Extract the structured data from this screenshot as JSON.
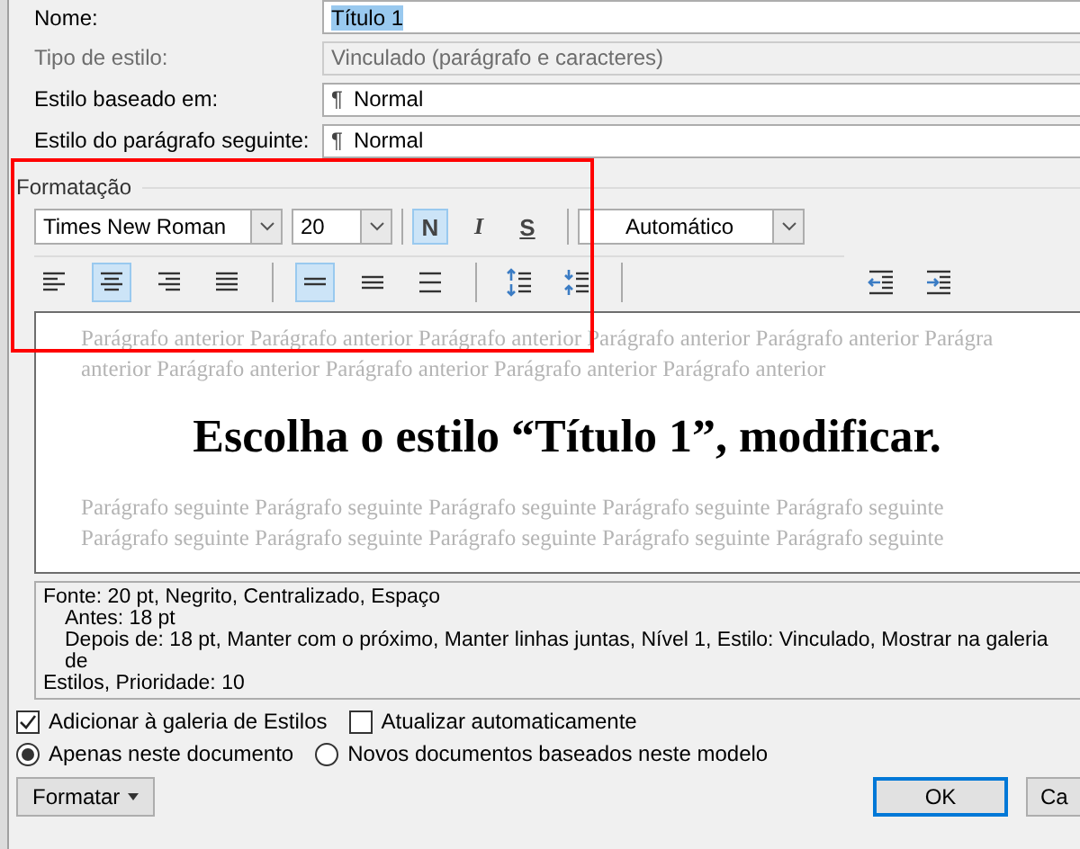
{
  "fields": [
    {
      "label": "Nome:",
      "value": "Título 1",
      "disabled": false,
      "kind": "text"
    },
    {
      "label": "Tipo de estilo:",
      "value": "Vinculado (parágrafo e caracteres)",
      "disabled": true,
      "kind": "text"
    },
    {
      "label": "Estilo baseado em:",
      "value": "Normal",
      "icon": "¶",
      "disabled": false,
      "kind": "style"
    },
    {
      "label": "Estilo do parágrafo seguinte:",
      "value": "Normal",
      "icon": "¶",
      "disabled": false,
      "kind": "style"
    }
  ],
  "formatting": {
    "title": "Formatação",
    "font": "Times New Roman",
    "size": "20",
    "styles": [
      {
        "label": "N",
        "kind": "bold",
        "selected": true
      },
      {
        "label": "I",
        "kind": "italic",
        "selected": false
      },
      {
        "label": "S",
        "kind": "underline",
        "selected": false
      }
    ],
    "color_label": "Automático",
    "tools": [
      {
        "kind": "align-left",
        "selected": false
      },
      {
        "kind": "align-center",
        "selected": true
      },
      {
        "kind": "align-right",
        "selected": false
      },
      {
        "kind": "justify",
        "selected": false
      },
      {
        "kind": "sep"
      },
      {
        "kind": "spacing-single",
        "selected": true
      },
      {
        "kind": "spacing-onehalf",
        "selected": false
      },
      {
        "kind": "spacing-double",
        "selected": false
      },
      {
        "kind": "sep"
      },
      {
        "kind": "space-more",
        "selected": false
      },
      {
        "kind": "space-less",
        "selected": false
      },
      {
        "kind": "sep"
      },
      {
        "kind": "indent-less",
        "selected": false
      },
      {
        "kind": "indent-more",
        "selected": false
      }
    ]
  },
  "preview": {
    "before": [
      "Parágrafo anterior Parágrafo anterior Parágrafo anterior Parágrafo anterior Parágrafo anterior Parágra",
      "anterior Parágrafo anterior Parágrafo anterior Parágrafo anterior Parágrafo anterior"
    ],
    "sample": "Escolha o estilo “Título 1”, modificar.",
    "after": [
      "Parágrafo seguinte Parágrafo seguinte Parágrafo seguinte Parágrafo seguinte Parágrafo seguinte",
      "Parágrafo seguinte Parágrafo seguinte Parágrafo seguinte Parágrafo seguinte Parágrafo seguinte"
    ]
  },
  "description": [
    {
      "text": "Fonte: 20 pt, Negrito, Centralizado, Espaço",
      "indented": false
    },
    {
      "text": "Antes:  18 pt",
      "indented": true
    },
    {
      "text": "Depois de:  18 pt, Manter com o próximo, Manter linhas juntas, Nível 1, Estilo: Vinculado, Mostrar na galeria de",
      "indented": true
    },
    {
      "text": "Estilos, Prioridade: 10",
      "indented": false
    }
  ],
  "checkboxes": [
    {
      "label": "Adicionar à galeria de Estilos",
      "checked": true
    },
    {
      "label": "Atualizar automaticamente",
      "checked": false
    }
  ],
  "radios": [
    {
      "label": "Apenas neste documento",
      "selected": true
    },
    {
      "label": "Novos documentos baseados neste modelo",
      "selected": false
    }
  ],
  "buttons": {
    "format": "Formatar",
    "ok": "OK",
    "cancel": "Ca"
  }
}
